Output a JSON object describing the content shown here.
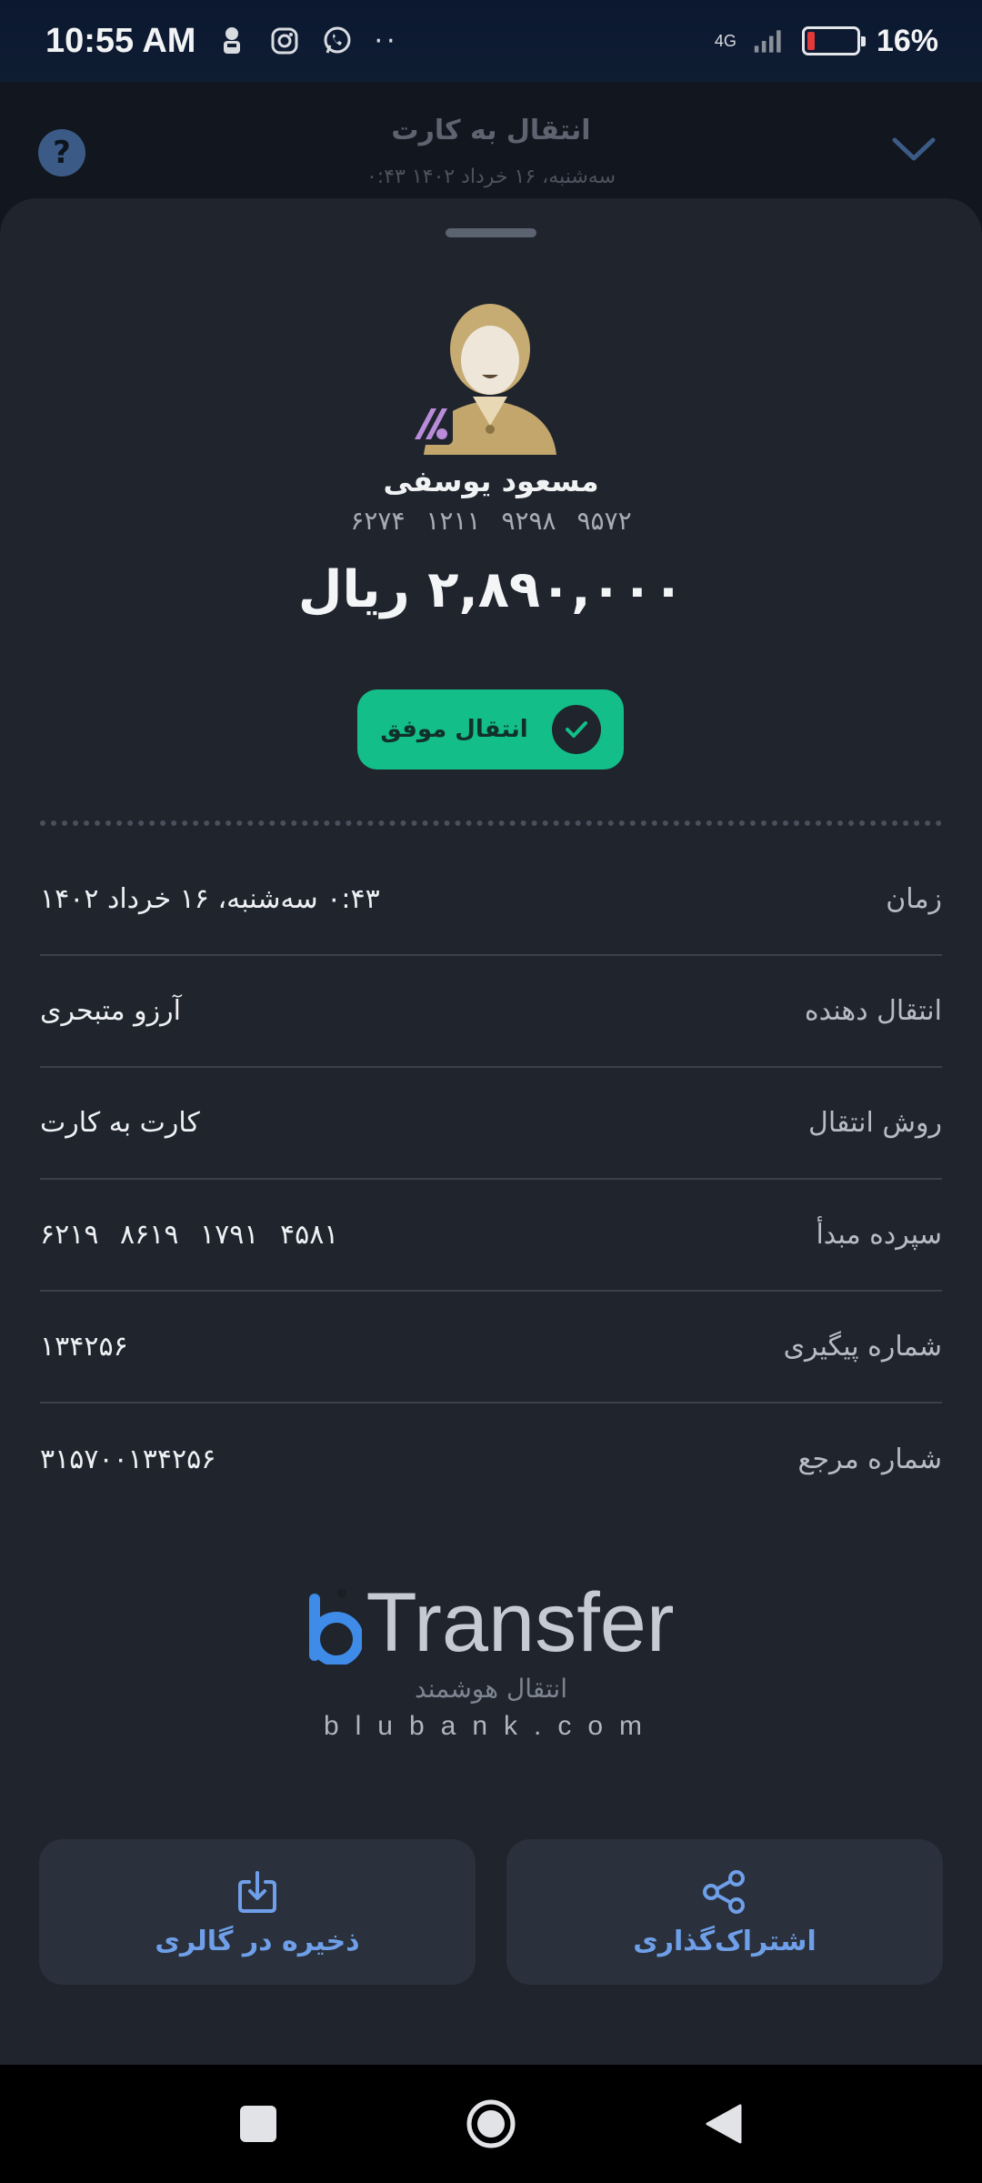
{
  "status_bar": {
    "time": "10:55 AM",
    "network": "4G",
    "battery_percent": "16%",
    "battery_level": 0.16
  },
  "header": {
    "title": "انتقال به کارت",
    "subtitle": "سه‌شنبه، ۱۶ خرداد ۱۴۰۲ ۰:۴۳",
    "help_label": "?"
  },
  "receipt": {
    "recipient_name": "مسعود یوسفی",
    "recipient_card": "۶۲۷۴ ۱۲۱۱ ۹۲۹۸ ۹۵۷۲",
    "amount": "۲,۸۹۰,۰۰۰ ریال",
    "status": "انتقال موفق",
    "rows": [
      {
        "label": "زمان",
        "value": "۰:۴۳ سه‌شنبه، ۱۶ خرداد ۱۴۰۲"
      },
      {
        "label": "انتقال دهنده",
        "value": "آرزو متبحری"
      },
      {
        "label": "روش انتقال",
        "value": "کارت به کارت"
      },
      {
        "label": "سپرده مبدأ",
        "value": "۶۲۱۹ ۸۶۱۹ ۱۷۹۱ ۴۵۸۱"
      },
      {
        "label": "شماره پیگیری",
        "value": "۱۳۴۲۵۶"
      },
      {
        "label": "شماره مرجع",
        "value": "۳۱۵۷۰۰۱۳۴۲۵۶"
      }
    ]
  },
  "brand": {
    "name": "Transfer",
    "tagline": "انتقال هوشمند",
    "url": "blubank.com"
  },
  "actions": {
    "save_label": "ذخیره در گالری",
    "share_label": "اشتراک‌گذاری"
  },
  "colors": {
    "sheet_bg": "#1f242d",
    "success": "#13be89",
    "accent_blue": "#6e9fe8"
  }
}
